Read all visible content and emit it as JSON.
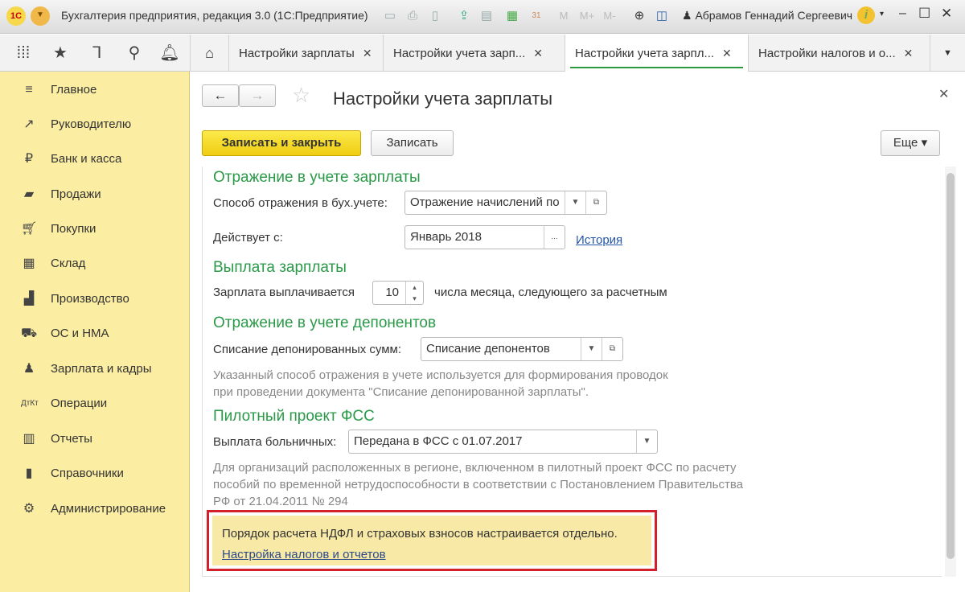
{
  "window": {
    "title": "Бухгалтерия предприятия, редакция 3.0  (1С:Предприятие)",
    "logo": "1С",
    "user": "Абрамов Геннадий Сергеевич",
    "toolbar_m": [
      "M",
      "M+",
      "M-"
    ]
  },
  "tabs": [
    {
      "label": "Настройки зарплаты",
      "active": false
    },
    {
      "label": "Настройки учета зарп...",
      "active": false
    },
    {
      "label": "Настройки учета зарпл...",
      "active": true
    },
    {
      "label": "Настройки налогов и о...",
      "active": false
    }
  ],
  "sidebar": {
    "items": [
      {
        "label": "Главное",
        "icon": "menu-icon"
      },
      {
        "label": "Руководителю",
        "icon": "chart-line-icon"
      },
      {
        "label": "Банк и касса",
        "icon": "ruble-icon"
      },
      {
        "label": "Продажи",
        "icon": "bag-icon"
      },
      {
        "label": "Покупки",
        "icon": "cart-icon"
      },
      {
        "label": "Склад",
        "icon": "warehouse-icon"
      },
      {
        "label": "Производство",
        "icon": "factory-icon"
      },
      {
        "label": "ОС и НМА",
        "icon": "truck-icon"
      },
      {
        "label": "Зарплата и кадры",
        "icon": "person-icon"
      },
      {
        "label": "Операции",
        "icon": "dt-kt-icon"
      },
      {
        "label": "Отчеты",
        "icon": "bar-chart-icon"
      },
      {
        "label": "Справочники",
        "icon": "books-icon"
      },
      {
        "label": "Администрирование",
        "icon": "gear-icon"
      }
    ]
  },
  "form": {
    "title": "Настройки учета зарплаты",
    "save_close": "Записать и закрыть",
    "save": "Записать",
    "more": "Еще",
    "sec1": {
      "title": "Отражение в учете зарплаты",
      "method_label": "Способ отражения в бух.учете:",
      "method_value": "Отражение начислений по",
      "date_label": "Действует с:",
      "date_value": "Январь 2018",
      "history": "История"
    },
    "sec2": {
      "title": "Выплата зарплаты",
      "label": "Зарплата выплачивается",
      "day": "10",
      "suffix": "числа месяца, следующего за расчетным"
    },
    "sec3": {
      "title": "Отражение в учете депонентов",
      "label": "Списание депонированных сумм:",
      "value": "Списание депонентов",
      "note1": "Указанный способ отражения в учете используется для формирования проводок",
      "note2": "при проведении документа \"Списание депонированной зарплаты\"."
    },
    "sec4": {
      "title": "Пилотный проект ФСС",
      "label": "Выплата больничных:",
      "value": "Передана в ФСС с 01.07.2017",
      "note1": "Для организаций расположенных в регионе, включенном в пилотный проект ФСС по расчету",
      "note2": "пособий по временной нетрудоспособности в соответствии с Постановлением Правительства",
      "note3": "РФ от 21.04.2011 № 294"
    },
    "info": {
      "text": "Порядок расчета НДФЛ и страховых взносов настраивается отдельно.",
      "link": "Настройка налогов и отчетов"
    }
  }
}
